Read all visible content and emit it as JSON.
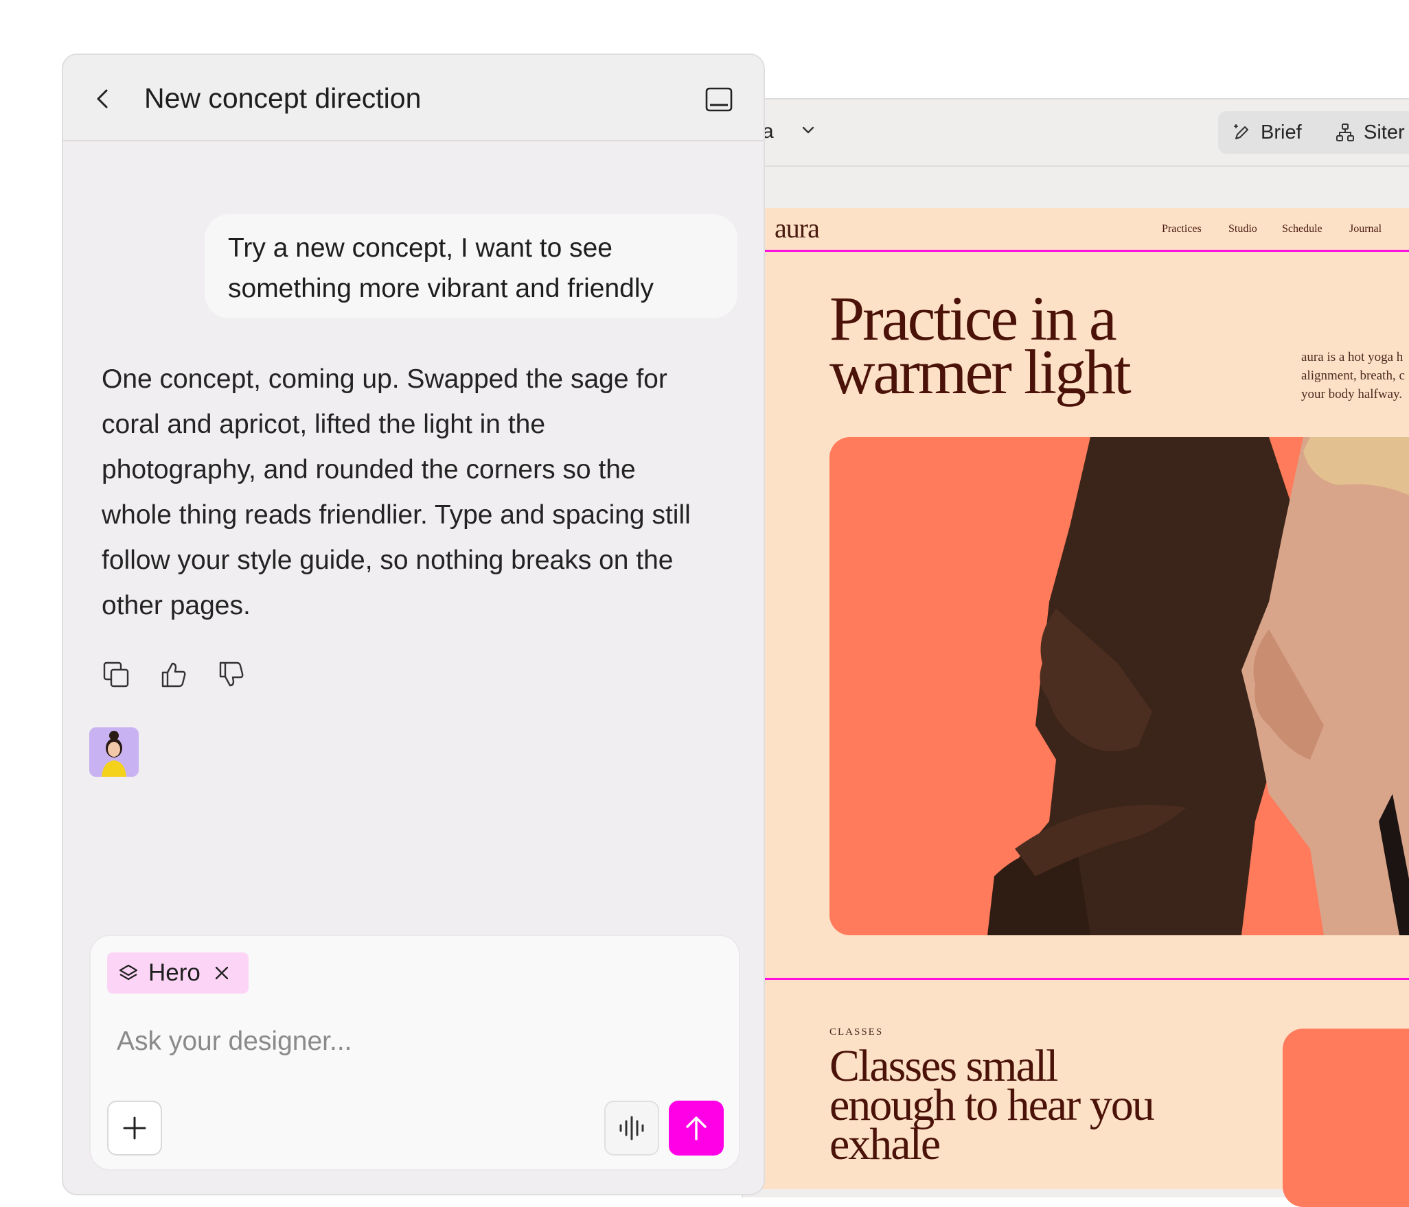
{
  "chat": {
    "title": "New concept direction",
    "user_message": "Try a new concept, I want to see something more vibrant and friendly",
    "assistant_message": "One concept, coming up. Swapped the sage for coral and apricot, lifted the light in the photography, and rounded the corners so the whole thing reads friendlier. Type and spacing still follow your style guide, so nothing breaks on the other pages.",
    "icons": {
      "back": "chevron-left-icon",
      "panel": "panel-toggle-icon",
      "copy": "copy-icon",
      "thumbs_up": "thumbs-up-icon",
      "thumbs_down": "thumbs-down-icon"
    }
  },
  "composer": {
    "chip_label": "Hero",
    "chip_icon": "layers-icon",
    "placeholder": "Ask your designer...",
    "send_color": "#ff00e6"
  },
  "editor": {
    "project_fragment": "a",
    "toolbar": {
      "brief_label": "Brief",
      "sitemap_label": "Siter"
    }
  },
  "site_preview": {
    "logo": "aura",
    "nav": [
      "Practices",
      "Studio",
      "Schedule",
      "Journal"
    ],
    "hero_title": "Practice in a warmer light",
    "hero_blurb_lines": [
      "aura is a hot yoga h",
      "alignment, breath, c",
      "your body halfway."
    ],
    "classes_kicker": "CLASSES",
    "classes_title": "Classes small enough to hear you exhale",
    "colors": {
      "background": "#fde1c6",
      "coral": "#ff7b5c",
      "text": "#4a1208",
      "selection": "#ff10e0"
    }
  }
}
